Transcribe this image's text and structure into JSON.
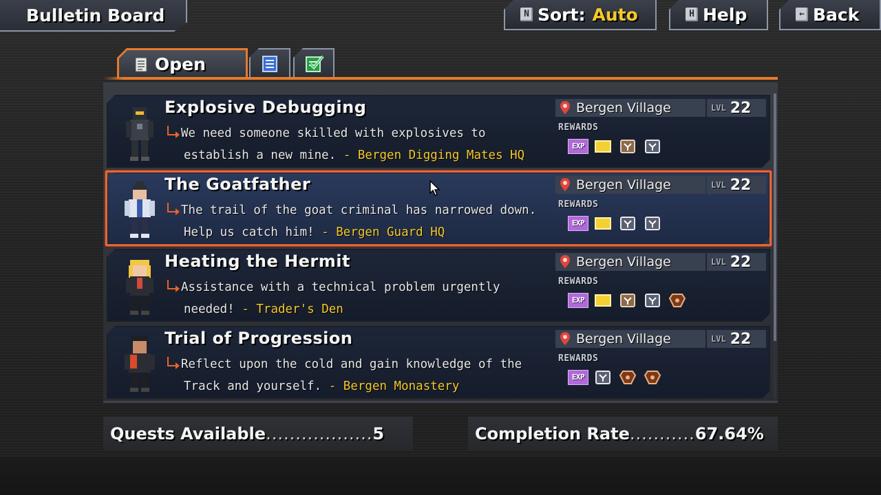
{
  "window": {
    "title": "Bulletin Board"
  },
  "top_buttons": {
    "sort": {
      "key": "N",
      "label": "Sort:",
      "value": "Auto"
    },
    "help": {
      "key": "H",
      "label": "Help"
    },
    "back": {
      "key": "←",
      "label": "Back"
    }
  },
  "tabs": {
    "open": {
      "label": "Open",
      "icon": "document-icon",
      "active": true
    },
    "list": {
      "icon": "quest-list-icon",
      "active": false
    },
    "completed": {
      "icon": "checked-list-icon",
      "active": false
    }
  },
  "rewards_label": "REWARDS",
  "level_label": "LVL",
  "quests": [
    {
      "title": "Explosive Debugging",
      "desc_line1": "We need someone skilled with explosives to",
      "desc_line2": "establish a new mine.",
      "giver": "- Bergen Digging Mates HQ",
      "location": "Bergen Village",
      "level": "22",
      "rewards": [
        "exp",
        "item",
        "trade-good",
        "trade-good"
      ],
      "selected": false
    },
    {
      "title": "The Goatfather",
      "desc_line1": "The trail of the goat criminal has narrowed down.",
      "desc_line2": "Help us catch him!",
      "giver": "- Bergen Guard HQ",
      "location": "Bergen Village",
      "level": "22",
      "rewards": [
        "exp",
        "item",
        "trade-good",
        "trade-good"
      ],
      "selected": true
    },
    {
      "title": "Heating the Hermit",
      "desc_line1": "Assistance with a technical problem urgently",
      "desc_line2": "needed!",
      "giver": "- Trader's Den",
      "location": "Bergen Village",
      "level": "22",
      "rewards": [
        "exp",
        "item",
        "trade-good",
        "trade-good",
        "special-item"
      ],
      "selected": false
    },
    {
      "title": "Trial of Progression",
      "desc_line1": "Reflect upon the cold and gain knowledge of the",
      "desc_line2": "Track and yourself.",
      "giver": "- Bergen Monastery",
      "location": "Bergen Village",
      "level": "22",
      "rewards": [
        "exp",
        "trade-good",
        "special-item",
        "special-item"
      ],
      "selected": false
    }
  ],
  "footer": {
    "quests_available_label": "Quests Available",
    "quests_available_dots": "..................",
    "quests_available_value": "5",
    "completion_label": "Completion Rate",
    "completion_dots": "...........",
    "completion_value": "67.64%"
  },
  "colors": {
    "accent_orange": "#e87a2a",
    "highlight_yellow": "#f5c92a",
    "card_bg": "#151c2b",
    "selected_border": "#e2663a",
    "exp_purple": "#b06ad8"
  }
}
